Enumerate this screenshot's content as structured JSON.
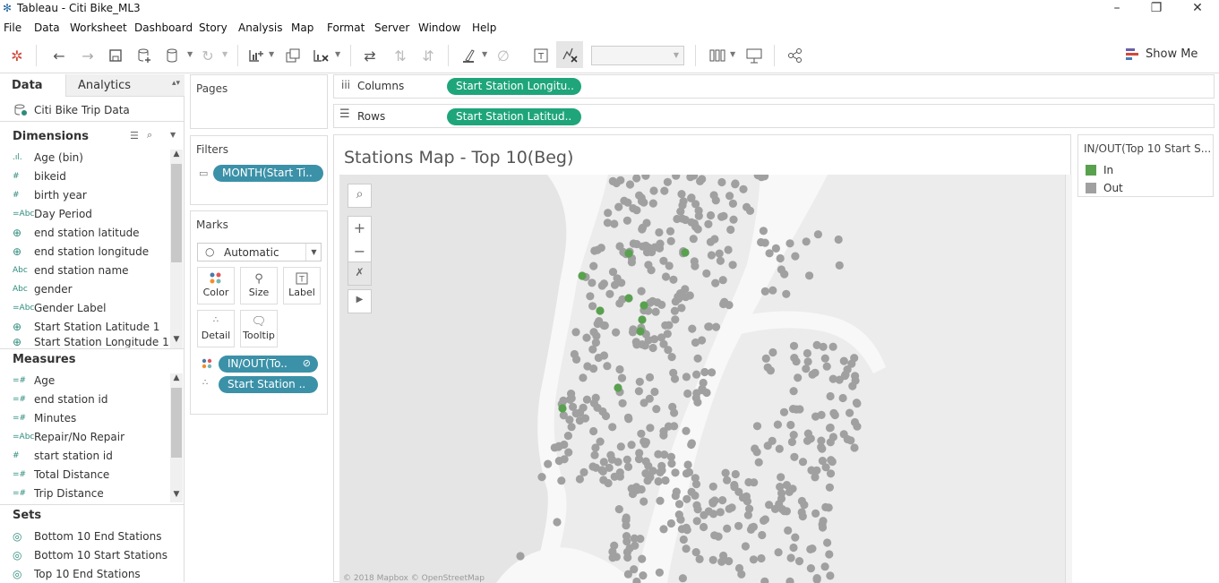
{
  "window": {
    "title": "Tableau - Citi Bike_ML3",
    "buttons": [
      "–",
      "❐",
      "✕"
    ]
  },
  "menu": [
    "File",
    "Data",
    "Worksheet",
    "Dashboard",
    "Story",
    "Analysis",
    "Map",
    "Format",
    "Server",
    "Window",
    "Help"
  ],
  "toolbar": {
    "show_me_label": "Show Me"
  },
  "left_pane": {
    "tabs": {
      "data": "Data",
      "analytics": "Analytics"
    },
    "datasource": "Citi Bike Trip Data",
    "dimensions_title": "Dimensions",
    "dimensions": [
      {
        "icon": ".ıl.",
        "label": "Age (bin)"
      },
      {
        "icon": "#",
        "label": "bikeid"
      },
      {
        "icon": "#",
        "label": "birth year"
      },
      {
        "icon": "=Abc",
        "label": "Day Period"
      },
      {
        "icon": "⊕",
        "label": "end station latitude"
      },
      {
        "icon": "⊕",
        "label": "end station longitude"
      },
      {
        "icon": "Abc",
        "label": "end station name"
      },
      {
        "icon": "Abc",
        "label": "gender"
      },
      {
        "icon": "=Abc",
        "label": "Gender Label"
      },
      {
        "icon": "⊕",
        "label": "Start Station Latitude 1"
      },
      {
        "icon": "⊕",
        "label": "Start Station Longitude 1"
      }
    ],
    "measures_title": "Measures",
    "measures": [
      {
        "icon": "=#",
        "label": "Age"
      },
      {
        "icon": "=#",
        "label": "end station id"
      },
      {
        "icon": "=#",
        "label": "Minutes"
      },
      {
        "icon": "=Abc",
        "label": "Repair/No Repair"
      },
      {
        "icon": "#",
        "label": "start station id"
      },
      {
        "icon": "=#",
        "label": "Total Distance"
      },
      {
        "icon": "=#",
        "label": "Trip Distance"
      }
    ],
    "sets_title": "Sets",
    "sets": [
      {
        "icon": "◎",
        "label": "Bottom 10 End Stations"
      },
      {
        "icon": "◎",
        "label": "Bottom 10 Start Stations"
      },
      {
        "icon": "◎",
        "label": "Top 10 End Stations"
      }
    ]
  },
  "pages": {
    "title": "Pages"
  },
  "filters": {
    "title": "Filters",
    "pill": "MONTH(Start Ti.."
  },
  "marks": {
    "title": "Marks",
    "type": "Automatic",
    "buttons": [
      "Color",
      "Size",
      "Label",
      "Detail",
      "Tooltip"
    ],
    "pills": [
      "IN/OUT(To..",
      "Start Station .."
    ]
  },
  "shelves": {
    "columns_label": "Columns",
    "columns_pill": "Start Station Longitu..",
    "rows_label": "Rows",
    "rows_pill": "Start Station Latitud.."
  },
  "view": {
    "title": "Stations Map - Top 10(Beg)",
    "map_credit": "© 2018 Mapbox © OpenStreetMap"
  },
  "legend": {
    "title": "IN/OUT(Top 10 Start S...",
    "items": [
      {
        "label": "In",
        "color": "#59a14f"
      },
      {
        "label": "Out",
        "color": "#a0a0a0"
      }
    ]
  },
  "colors": {
    "accent_green": "#1fa57a",
    "pill_teal": "#3b91a8",
    "in": "#59a14f",
    "out": "#a0a0a0"
  }
}
